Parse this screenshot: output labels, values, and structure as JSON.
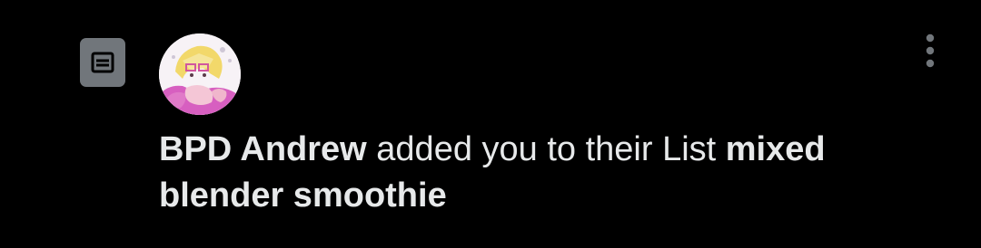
{
  "notification": {
    "type_icon": "list-icon",
    "avatar_icon": "user-avatar",
    "more_icon": "more-vertical-icon",
    "actor_name": "BPD Andrew",
    "action_text": " added you to their List ",
    "list_name": "mixed blender smoothie"
  },
  "colors": {
    "background": "#000000",
    "text": "#e7e9ea",
    "icon_gray": "#71767b"
  }
}
